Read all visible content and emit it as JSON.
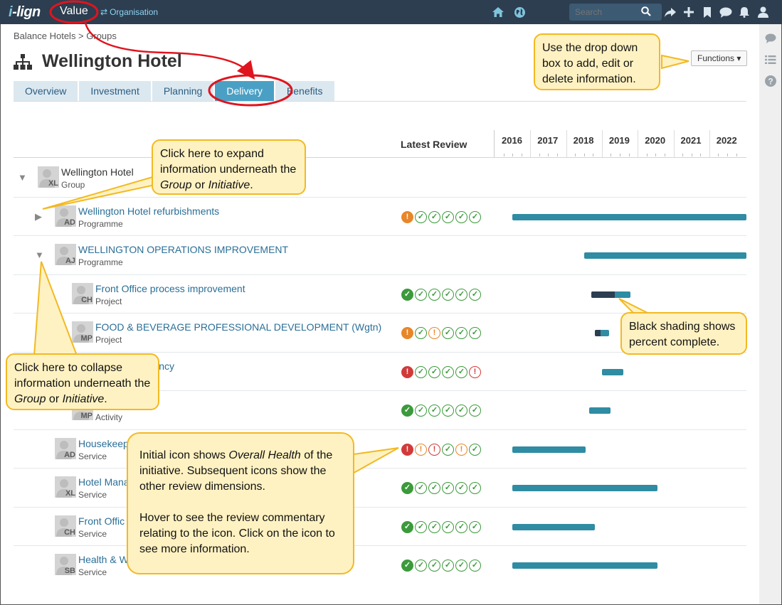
{
  "topbar": {
    "logo_prefix": "i",
    "logo_suffix": "-lign",
    "value_label": "Value",
    "org_link_label": "Organisation",
    "search_placeholder": "Search"
  },
  "breadcrumb": "Balance Hotels > Groups",
  "page_title": "Wellington Hotel",
  "functions_label": "Functions ▾",
  "tabs": [
    {
      "label": "Overview"
    },
    {
      "label": "Investment"
    },
    {
      "label": "Planning"
    },
    {
      "label": "Delivery"
    },
    {
      "label": "Benefits"
    }
  ],
  "table": {
    "latest_review_label": "Latest Review",
    "years": [
      "2016",
      "2017",
      "2018",
      "2019",
      "2020",
      "2021",
      "2022"
    ]
  },
  "rows": [
    {
      "name": "Wellington Hotel",
      "type": "Group",
      "initials": "XL",
      "caret": "▼",
      "statuses": [],
      "bar": null
    },
    {
      "name": "Wellington Hotel refurbishments",
      "type": "Programme",
      "initials": "AD",
      "caret": "▶",
      "statuses": [
        "warnf",
        "ok",
        "ok",
        "ok",
        "ok",
        "ok"
      ],
      "bar": {
        "start": 2016.5,
        "end": 2023.5,
        "pct": 0
      }
    },
    {
      "name": "WELLINGTON OPERATIONS IMPROVEMENT",
      "type": "Programme",
      "initials": "AJ",
      "caret": "▼",
      "statuses": [],
      "bar": {
        "start": 2018.5,
        "end": 2023.5,
        "pct": 0
      }
    },
    {
      "name": "Front Office process improvement",
      "type": "Project",
      "initials": "CH",
      "caret": "",
      "statuses": [
        "okf",
        "ok",
        "ok",
        "ok",
        "ok",
        "ok"
      ],
      "bar": {
        "start": 2018.7,
        "end": 2019.8,
        "pct": 60
      }
    },
    {
      "name": "FOOD & BEVERAGE PROFESSIONAL DEVELOPMENT (Wgtn)",
      "type": "Project",
      "initials": "MP",
      "caret": "",
      "statuses": [
        "warnf",
        "ok",
        "warn",
        "ok",
        "ok",
        "ok"
      ],
      "bar": {
        "start": 2018.8,
        "end": 2019.2,
        "pct": 40
      }
    },
    {
      "name": "cleaning effciency",
      "type": "",
      "initials": "",
      "caret": "",
      "statuses": [
        "badf",
        "ok",
        "ok",
        "ok",
        "ok",
        "bad"
      ],
      "bar": {
        "start": 2019.0,
        "end": 2019.6,
        "pct": 0
      }
    },
    {
      "name": "g",
      "type": "Activity",
      "initials": "MP",
      "caret": "",
      "statuses": [
        "okf",
        "ok",
        "ok",
        "ok",
        "ok",
        "ok"
      ],
      "bar": {
        "start": 2018.65,
        "end": 2019.25,
        "pct": 0
      }
    },
    {
      "name": "Housekeepi",
      "type": "Service",
      "initials": "AD",
      "caret": "",
      "statuses": [
        "badf",
        "warn",
        "bad",
        "ok",
        "warn",
        "ok"
      ],
      "bar": {
        "start": 2016.5,
        "end": 2018.55,
        "pct": 0
      }
    },
    {
      "name": "Hotel Mana",
      "type": "Service",
      "initials": "XL",
      "caret": "",
      "statuses": [
        "okf",
        "ok",
        "ok",
        "ok",
        "ok",
        "ok"
      ],
      "bar": {
        "start": 2016.5,
        "end": 2020.55,
        "pct": 0
      }
    },
    {
      "name": "Front Offic",
      "type": "Service",
      "initials": "CH",
      "caret": "",
      "statuses": [
        "okf",
        "ok",
        "ok",
        "ok",
        "ok",
        "ok"
      ],
      "bar": {
        "start": 2016.5,
        "end": 2018.8,
        "pct": 0
      }
    },
    {
      "name": "Health & W",
      "type": "Service",
      "initials": "SB",
      "caret": "",
      "statuses": [
        "okf",
        "ok",
        "ok",
        "ok",
        "ok",
        "ok"
      ],
      "bar": {
        "start": 2016.5,
        "end": 2020.55,
        "pct": 0
      }
    }
  ],
  "callouts": {
    "functions_tip": "Use the drop down box to add, edit or delete information.",
    "expand_tip_1": "Click here to expand information underneath the ",
    "expand_tip_group": "Group",
    "expand_tip_or": " or ",
    "expand_tip_initiative": "Initiative",
    "expand_tip_end": ".",
    "collapse_tip_1": "Click here to collapse information underneath the ",
    "collapse_tip_group": "Group",
    "collapse_tip_or": " or ",
    "collapse_tip_initiative": "Initiative",
    "collapse_tip_end": ".",
    "shading_tip": "Black shading shows percent complete.",
    "health_tip_1": "Initial icon shows ",
    "health_tip_em": "Overall Health",
    "health_tip_2": " of the initiative.  Subsequent icons show the other review dimensions.",
    "health_tip_3": "Hover to see the review commentary relating to the icon.   Click on the icon to see more information."
  },
  "colors": {
    "topbar": "#2c3e50",
    "tab_active": "#4aa0c4",
    "gantt_bar": "#2f8ca3",
    "gantt_done": "#2c3e50",
    "status_ok": "#3b9a3b",
    "status_warn": "#e8862a",
    "status_bad": "#d23a3a",
    "callout_fill": "#fff2c2",
    "callout_border": "#f2b923",
    "highlight_red": "#e0141e"
  }
}
